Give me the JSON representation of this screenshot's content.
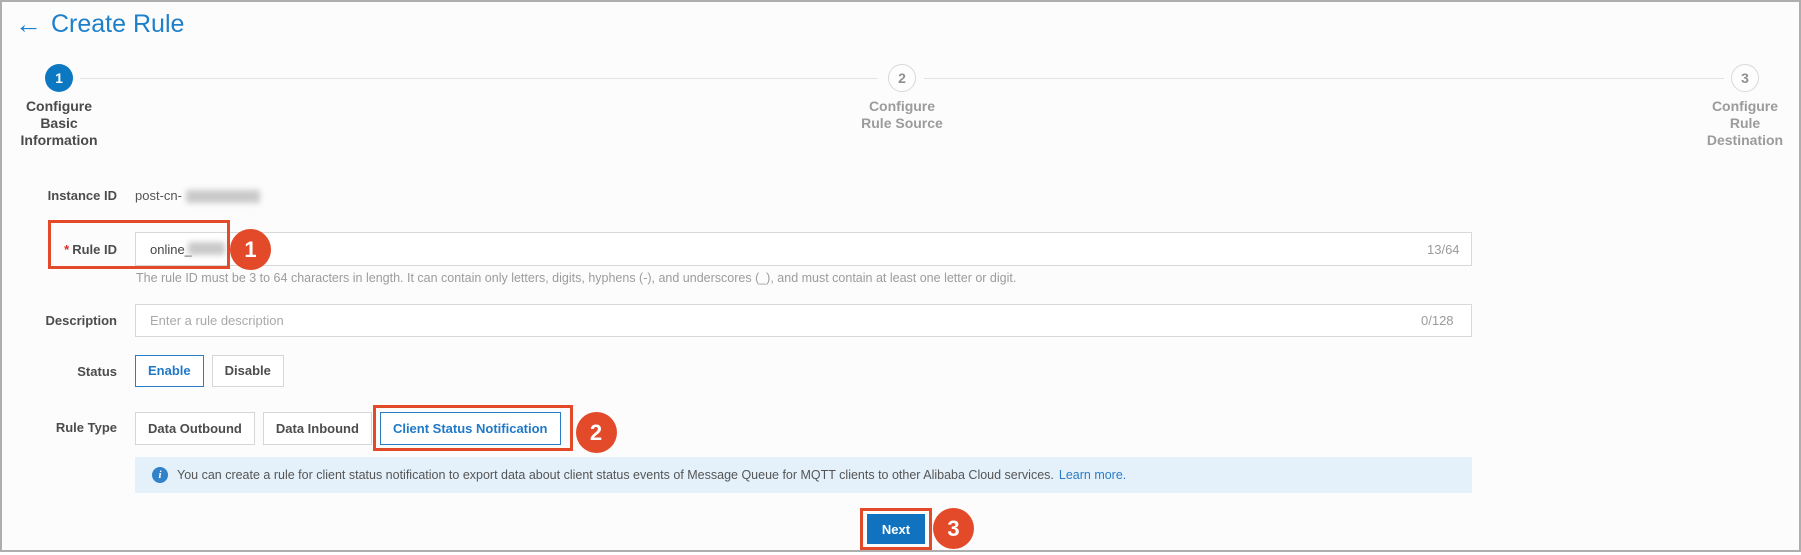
{
  "header": {
    "title": "Create Rule"
  },
  "icons": {
    "back_arrow": "←",
    "info": "i"
  },
  "stepper": {
    "steps": [
      {
        "number": "1",
        "label": "Configure Basic Information"
      },
      {
        "number": "2",
        "label": "Configure Rule Source"
      },
      {
        "number": "3",
        "label": "Configure Rule Destination"
      }
    ]
  },
  "form": {
    "instance_id": {
      "label": "Instance ID",
      "value_prefix": "post-cn-"
    },
    "rule_id": {
      "required_marker": "*",
      "label": "Rule ID",
      "value_prefix": "online_",
      "counter": "13/64",
      "help": "The rule ID must be 3 to 64 characters in length. It can contain only letters, digits, hyphens (-), and underscores (_), and must contain at least one letter or digit."
    },
    "description": {
      "label": "Description",
      "placeholder": "Enter a rule description",
      "counter": "0/128"
    },
    "status": {
      "label": "Status",
      "options": [
        "Enable",
        "Disable"
      ],
      "selected": "Enable"
    },
    "rule_type": {
      "label": "Rule Type",
      "options": [
        "Data Outbound",
        "Data Inbound",
        "Client Status Notification"
      ],
      "selected": "Client Status Notification"
    },
    "info_banner": {
      "text": "You can create a rule for client status notification to export data about client status events of Message Queue for MQTT clients to other Alibaba Cloud services.",
      "link": "Learn more."
    },
    "next_button": "Next"
  },
  "annotations": {
    "badge_1": "1",
    "badge_2": "2",
    "badge_3": "3"
  },
  "colors": {
    "brand_blue": "#1e7fca",
    "step_active_blue": "#0d78c2",
    "next_blue": "#1173bf",
    "annotation_orange": "#e24a29",
    "banner_bg": "#e4f1fb"
  }
}
